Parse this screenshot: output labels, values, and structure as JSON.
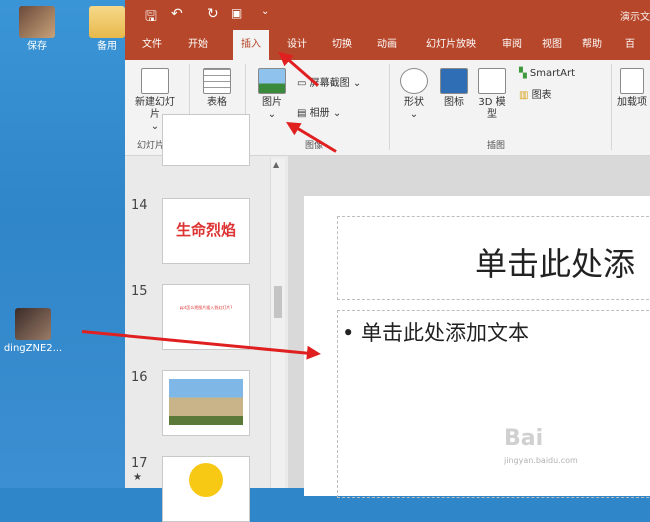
{
  "desktop": {
    "icons": [
      {
        "label": "保存"
      },
      {
        "label": "备用"
      },
      {
        "label": "dingZNE2..."
      }
    ]
  },
  "titlebar": {
    "doc_title": "演示文"
  },
  "tabs": [
    "文件",
    "开始",
    "插入",
    "设计",
    "切换",
    "动画",
    "幻灯片放映",
    "审阅",
    "视图",
    "帮助",
    "百"
  ],
  "active_tab": "插入",
  "ribbon": {
    "new_slide": "新建幻灯片",
    "slides_group": "幻灯片",
    "table": "表格",
    "table_group": "表格",
    "picture": "图片",
    "screenshot": "屏幕截图",
    "album": "相册",
    "images_group": "图像",
    "shapes": "形状",
    "icons": "图标",
    "model3d": "3D 模型",
    "smartart": "SmartArt",
    "chart": "图表",
    "illustrations_group": "插图",
    "addins": "加载项"
  },
  "thumbnails": [
    {
      "num": "14",
      "text": "生命烈焰"
    },
    {
      "num": "15",
      "text": "ppt怎么把图片插入到幻灯片?"
    },
    {
      "num": "16",
      "text": ""
    },
    {
      "num": "17",
      "text": ""
    }
  ],
  "slide": {
    "title_placeholder": "单击此处添",
    "body_placeholder": "• 单击此处添加文本"
  },
  "watermark": {
    "brand": "Bai",
    "sub": "jingyan.baidu.com"
  },
  "colors": {
    "accent": "#b7472a",
    "arrow": "#e02020"
  }
}
